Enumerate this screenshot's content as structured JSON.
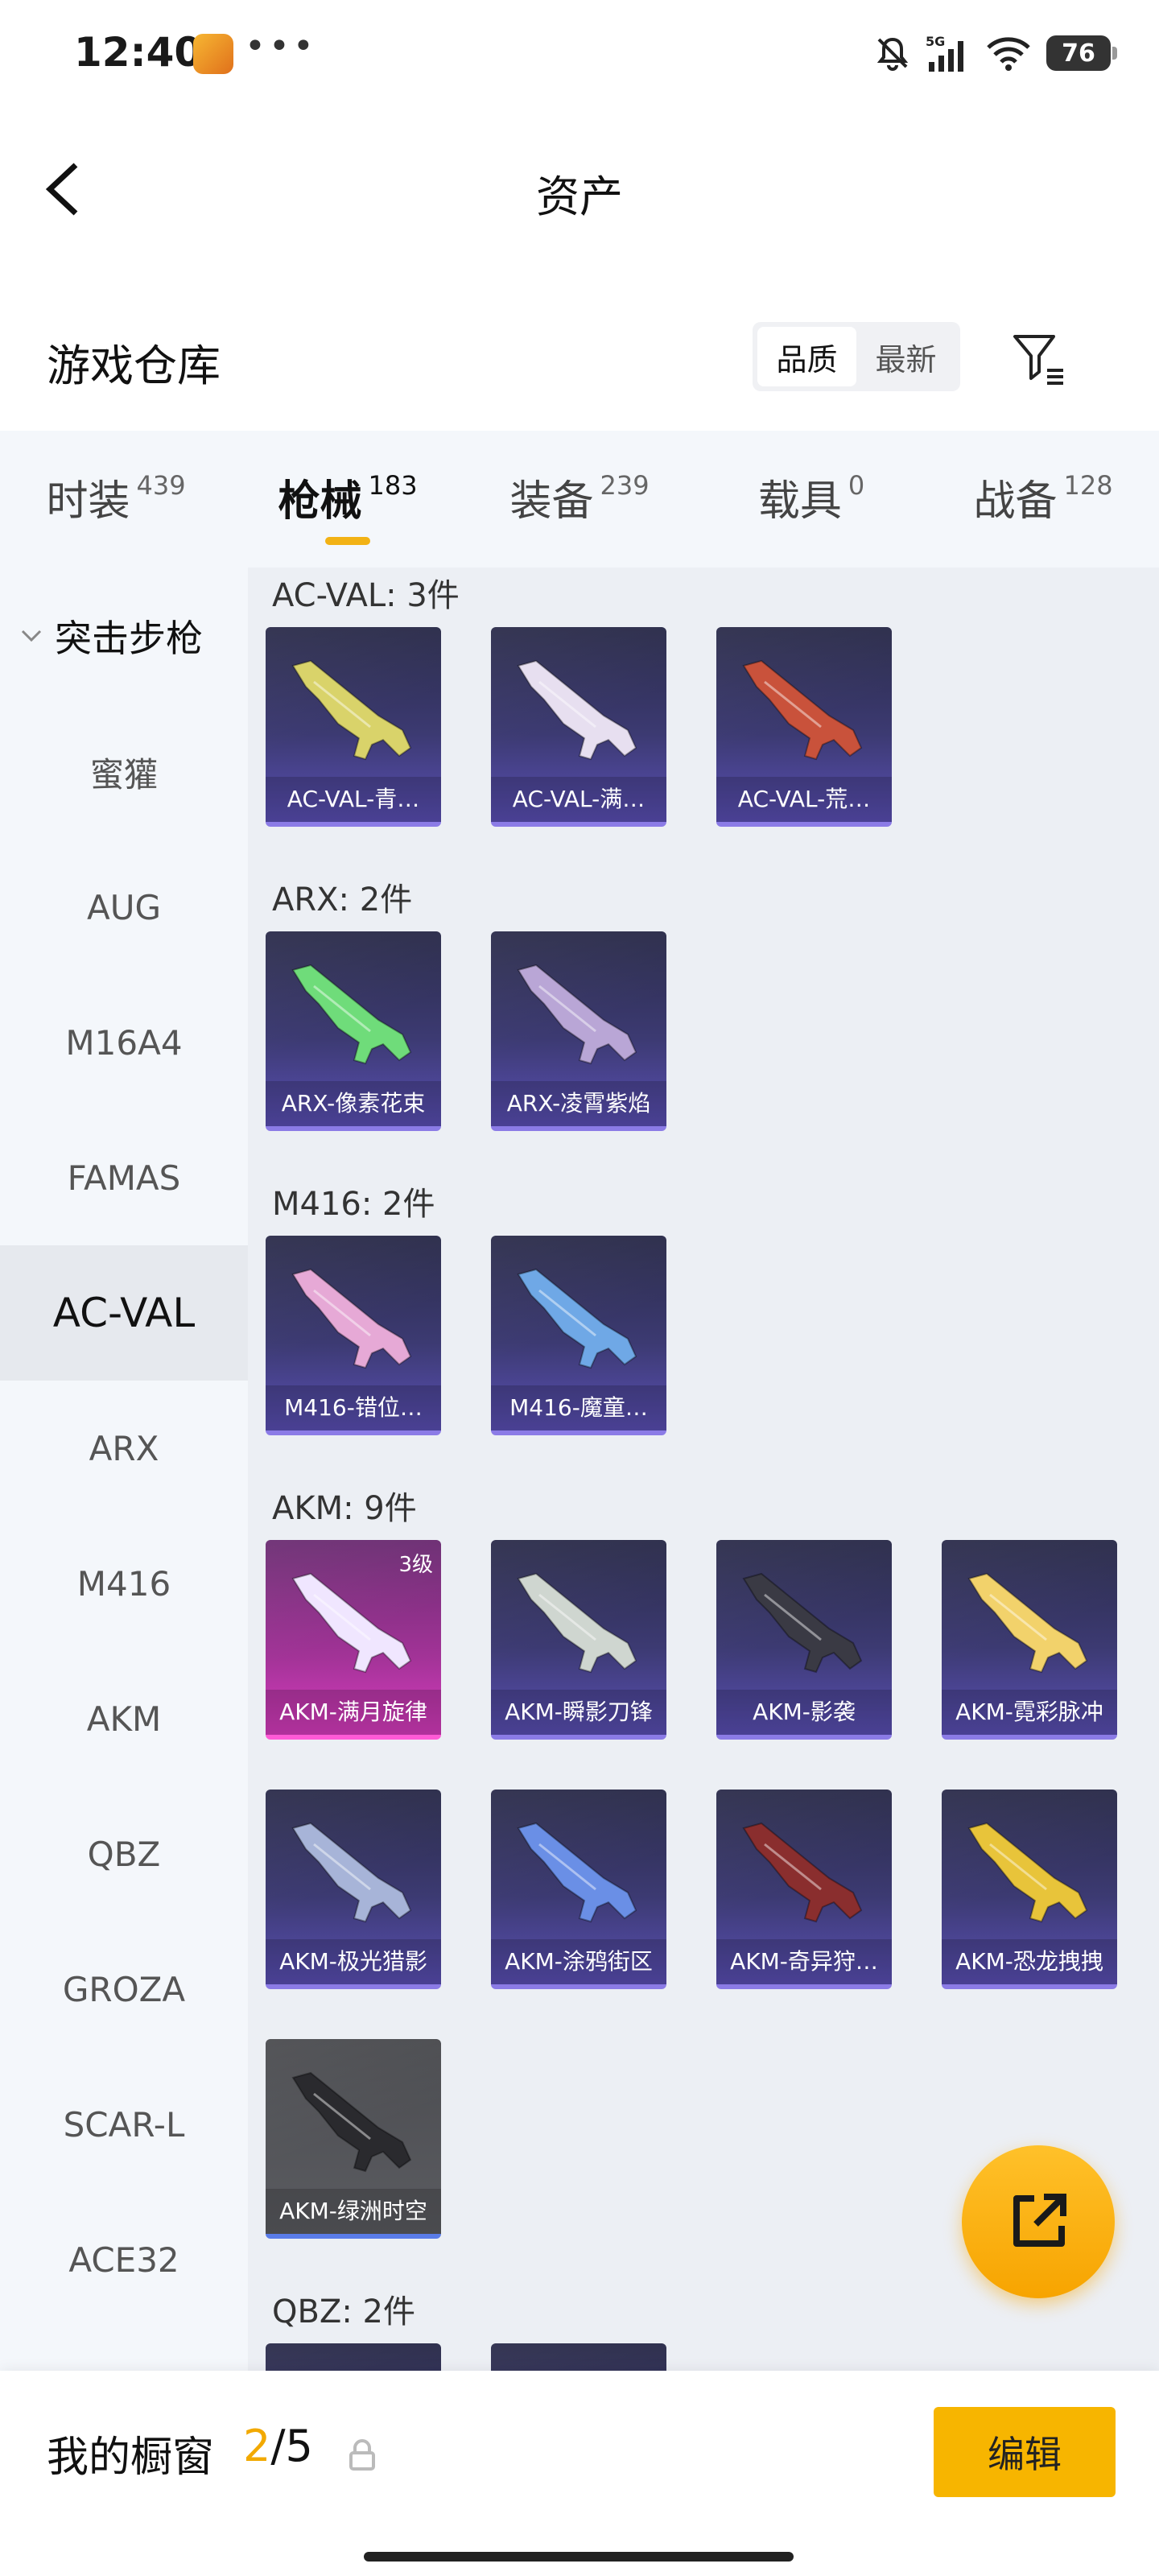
{
  "status_bar": {
    "time": "12:40",
    "battery": "76",
    "signal_label": "5G",
    "dots": "•••"
  },
  "header": {
    "title": "资产"
  },
  "section": {
    "title": "游戏仓库",
    "sort_options": [
      "品质",
      "最新"
    ],
    "active_sort": "品质"
  },
  "tabs": [
    {
      "label": "时装",
      "count": "439"
    },
    {
      "label": "枪械",
      "count": "183"
    },
    {
      "label": "装备",
      "count": "239"
    },
    {
      "label": "载具",
      "count": "0"
    },
    {
      "label": "战备",
      "count": "128"
    }
  ],
  "active_tab": "枪械",
  "sidebar": {
    "category": "突击步枪",
    "items": [
      "蜜獾",
      "AUG",
      "M16A4",
      "FAMAS",
      "AC-VAL",
      "ARX",
      "M416",
      "AKM",
      "QBZ",
      "GROZA",
      "SCAR-L",
      "ACE32"
    ],
    "active": "AC-VAL"
  },
  "groups": [
    {
      "title": "AC-VAL: 3件",
      "items": [
        {
          "name": "AC-VAL-青…",
          "tone": "purple",
          "gun": "#d9d36a"
        },
        {
          "name": "AC-VAL-满…",
          "tone": "purple",
          "gun": "#e7dff0"
        },
        {
          "name": "AC-VAL-荒…",
          "tone": "purple",
          "gun": "#c9523b"
        }
      ]
    },
    {
      "title": "ARX: 2件",
      "items": [
        {
          "name": "ARX-像素花束",
          "tone": "purple",
          "gun": "#6fdc7a"
        },
        {
          "name": "ARX-凌霄紫焰",
          "tone": "purple",
          "gun": "#b9a6d6"
        }
      ]
    },
    {
      "title": "M416: 2件",
      "items": [
        {
          "name": "M416-错位…",
          "tone": "purple",
          "gun": "#e6a9d6"
        },
        {
          "name": "M416-魔童…",
          "tone": "purple",
          "gun": "#6fa8e6"
        }
      ]
    },
    {
      "title": "AKM: 9件",
      "items": [
        {
          "name": "AKM-满月旋律",
          "tone": "pink",
          "gun": "#f0e6ff",
          "level": "3级"
        },
        {
          "name": "AKM-瞬影刀锋",
          "tone": "purple",
          "gun": "#cfd6d0"
        },
        {
          "name": "AKM-影袭",
          "tone": "purple",
          "gun": "#3a3a44"
        },
        {
          "name": "AKM-霓彩脉冲",
          "tone": "purple",
          "gun": "#f2d26b"
        },
        {
          "name": "AKM-极光猎影",
          "tone": "purple",
          "gun": "#a7b4d8"
        },
        {
          "name": "AKM-涂鸦街区",
          "tone": "purple",
          "gun": "#6a8fe6"
        },
        {
          "name": "AKM-奇异狩…",
          "tone": "purple",
          "gun": "#8a2e2e"
        },
        {
          "name": "AKM-恐龙拽拽",
          "tone": "purple",
          "gun": "#e8c43a"
        },
        {
          "name": "AKM-绿洲时空",
          "tone": "gray",
          "gun": "#2a2a2e"
        }
      ]
    },
    {
      "title": "QBZ: 2件",
      "items": [
        {
          "name": "",
          "tone": "purple",
          "gun": "#cfd6e6"
        },
        {
          "name": "",
          "tone": "purple",
          "gun": "#7ab6e6"
        }
      ]
    }
  ],
  "showcase": {
    "label": "我的橱窗",
    "current": "2",
    "total": "/5"
  },
  "edit_button": "编辑",
  "colors": {
    "accent": "#f7b500",
    "highlight": "#f2a900"
  }
}
